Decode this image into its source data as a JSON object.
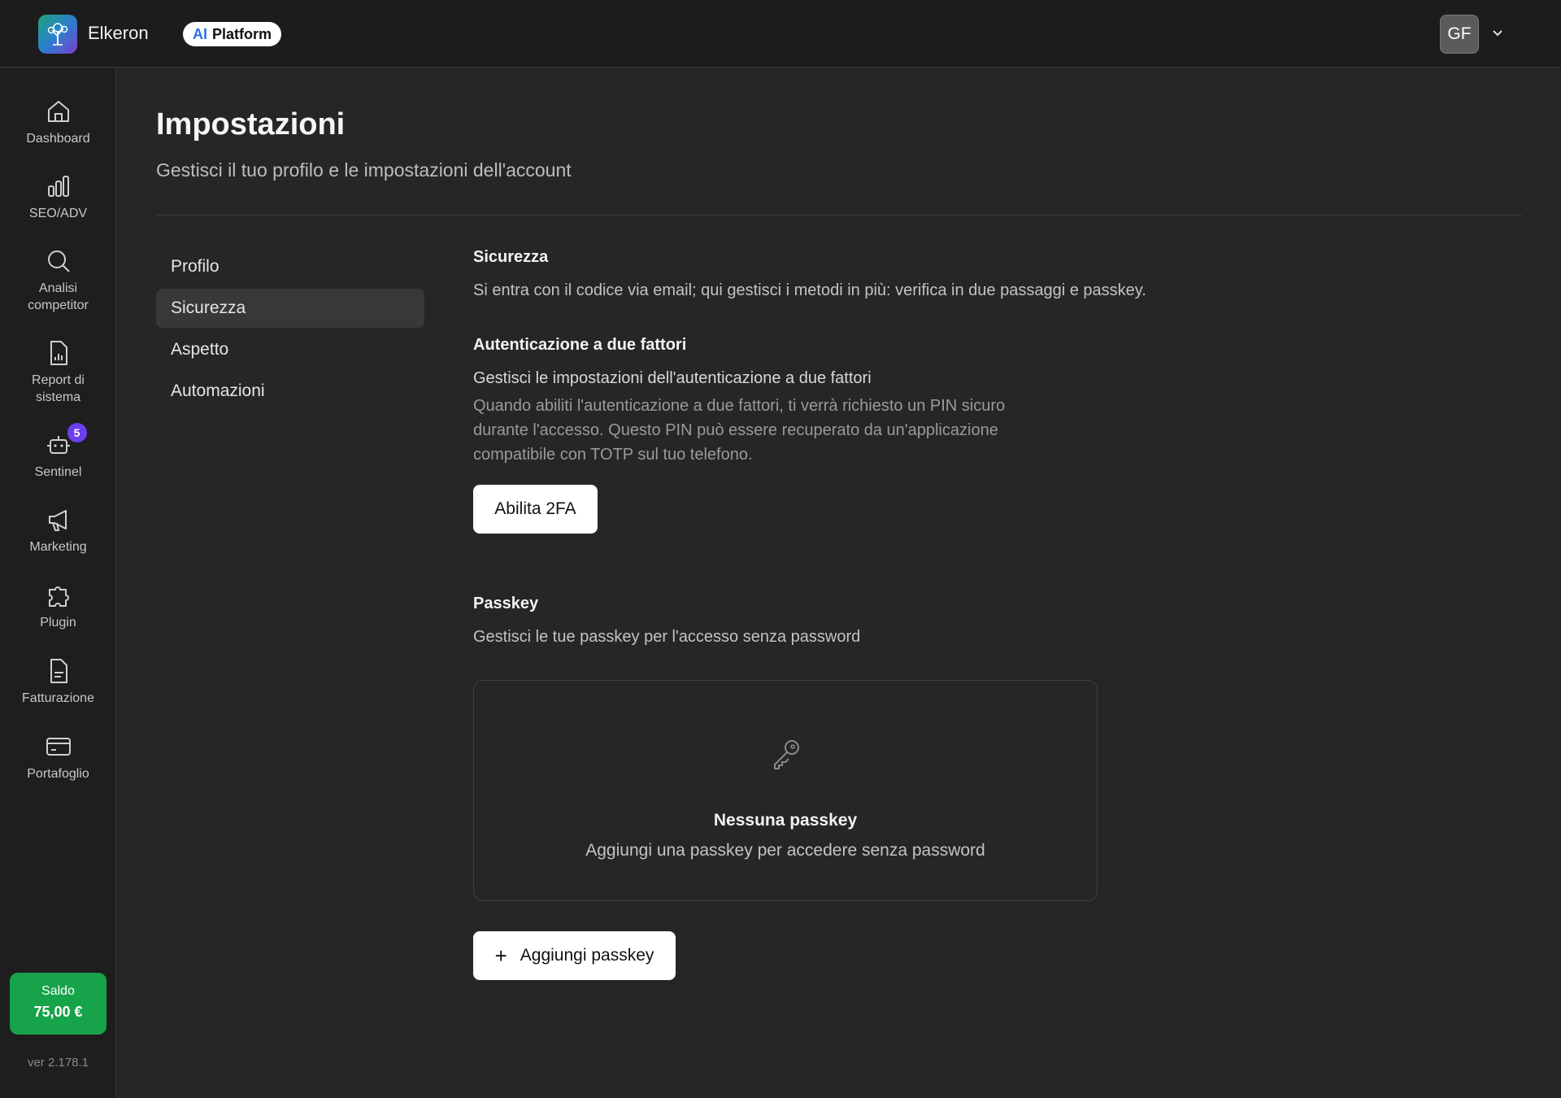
{
  "header": {
    "app_name": "Elkeron",
    "badge_ai": "AI",
    "badge_platform": "Platform",
    "user_initials": "GF"
  },
  "sidebar": {
    "items": [
      {
        "label": "Dashboard",
        "icon": "home-icon"
      },
      {
        "label": "SEO/ADV",
        "icon": "bar-chart-icon"
      },
      {
        "label": "Analisi competitor",
        "icon": "search-icon"
      },
      {
        "label": "Report di sistema",
        "icon": "report-icon"
      },
      {
        "label": "Sentinel",
        "icon": "robot-icon",
        "badge": "5"
      },
      {
        "label": "Marketing",
        "icon": "megaphone-icon"
      },
      {
        "label": "Plugin",
        "icon": "puzzle-icon"
      },
      {
        "label": "Fatturazione",
        "icon": "invoice-icon"
      },
      {
        "label": "Portafoglio",
        "icon": "wallet-icon"
      }
    ],
    "balance_label": "Saldo",
    "balance_value": "75,00 €",
    "version": "ver 2.178.1"
  },
  "page": {
    "title": "Impostazioni",
    "subtitle": "Gestisci il tuo profilo e le impostazioni dell'account"
  },
  "settings_nav": {
    "items": [
      "Profilo",
      "Sicurezza",
      "Aspetto",
      "Automazioni"
    ],
    "active": "Sicurezza"
  },
  "security": {
    "title": "Sicurezza",
    "description": "Si entra con il codice via email; qui gestisci i metodi in più: verifica in due passaggi e passkey.",
    "tfa_title": "Autenticazione a due fattori",
    "tfa_subtitle": "Gestisci le impostazioni dell'autenticazione a due fattori",
    "tfa_description": "Quando abiliti l'autenticazione a due fattori, ti verrà richiesto un PIN sicuro durante l'accesso. Questo PIN può essere recuperato da un'applicazione compatibile con TOTP sul tuo telefono.",
    "tfa_button": "Abilita 2FA",
    "passkey_title": "Passkey",
    "passkey_subtitle": "Gestisci le tue passkey per l'accesso senza password",
    "passkey_empty_title": "Nessuna passkey",
    "passkey_empty_sub": "Aggiungi una passkey per accedere senza password",
    "passkey_button": "Aggiungi passkey"
  },
  "colors": {
    "background": "#262626",
    "sidebar": "#1e1e1e",
    "balance": "#16a34a",
    "badge": "#6d3ef0"
  }
}
